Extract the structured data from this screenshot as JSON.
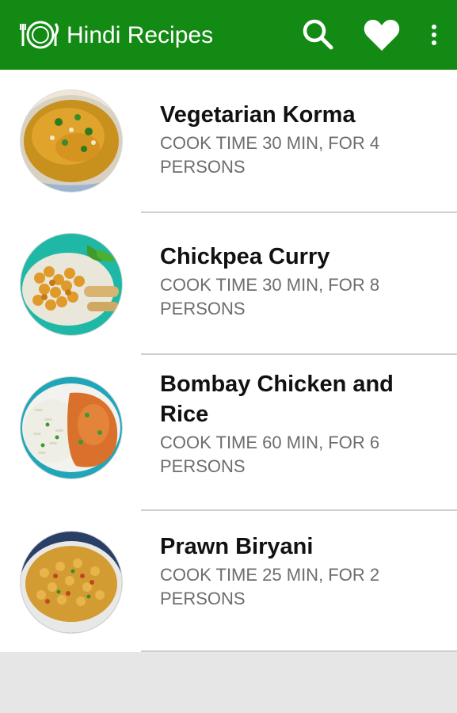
{
  "app_bar": {
    "title": "Hindi Recipes",
    "background_color": "#138a13",
    "logo_icon": "plate-cutlery-icon",
    "actions": [
      "search-icon",
      "heart-icon",
      "more-vert-icon"
    ]
  },
  "recipes": [
    {
      "title": "Vegetarian Korma",
      "subtitle": "COOK TIME 30 MIN, FOR 4 PERSONS",
      "image": "korma-dish"
    },
    {
      "title": "Chickpea Curry",
      "subtitle": "COOK TIME 30 MIN, FOR 8 PERSONS",
      "image": "chickpea-dish"
    },
    {
      "title": "Bombay Chicken and Rice",
      "subtitle": "COOK TIME 60 MIN, FOR 6 PERSONS",
      "image": "chicken-rice-dish"
    },
    {
      "title": "Prawn Biryani",
      "subtitle": "COOK TIME 25 MIN, FOR 2 PERSONS",
      "image": "biryani-dish"
    }
  ]
}
